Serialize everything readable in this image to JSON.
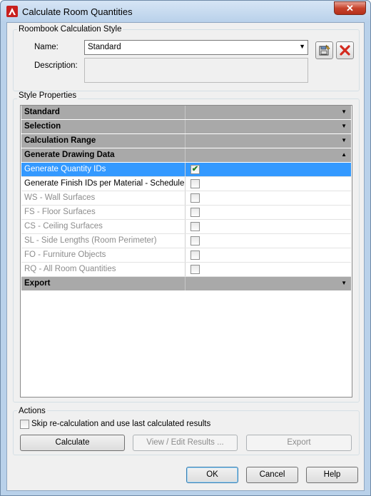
{
  "window": {
    "title": "Calculate Room Quantities",
    "close_glyph": "✕"
  },
  "style_group": {
    "label": "Roombook Calculation Style",
    "name_label": "Name:",
    "name_value": "Standard",
    "description_label": "Description:",
    "description_value": ""
  },
  "properties": {
    "label": "Style Properties",
    "rows": [
      {
        "name": "Standard",
        "kind": "category",
        "arrow": "▼"
      },
      {
        "name": "Selection",
        "kind": "category",
        "arrow": "▼"
      },
      {
        "name": "Calculation Range",
        "kind": "category",
        "arrow": "▼"
      },
      {
        "name": "Generate Drawing Data",
        "kind": "category",
        "arrow": "▲"
      },
      {
        "name": "Generate Quantity IDs",
        "kind": "selected",
        "checked": true
      },
      {
        "name": "Generate Finish IDs per Material - Schedule",
        "kind": "enabled",
        "checked": false
      },
      {
        "name": "WS - Wall Surfaces",
        "kind": "disabled",
        "checked": false
      },
      {
        "name": "FS - Floor Surfaces",
        "kind": "disabled",
        "checked": false
      },
      {
        "name": "CS - Ceiling Surfaces",
        "kind": "disabled",
        "checked": false
      },
      {
        "name": "SL - Side Lengths (Room Perimeter)",
        "kind": "disabled",
        "checked": false
      },
      {
        "name": "FO - Furniture Objects",
        "kind": "disabled",
        "checked": false
      },
      {
        "name": "RQ - All Room Quantities",
        "kind": "disabled",
        "checked": false
      },
      {
        "name": "Export",
        "kind": "category",
        "arrow": "▼"
      }
    ]
  },
  "actions": {
    "label": "Actions",
    "skip_label": "Skip re-calculation and use last calculated results",
    "skip_checked": false,
    "calculate_label": "Calculate",
    "view_edit_label": "View / Edit Results ...",
    "export_label": "Export"
  },
  "footer": {
    "ok_label": "OK",
    "cancel_label": "Cancel",
    "help_label": "Help"
  },
  "colors": {
    "selection": "#3399ff",
    "category": "#a9a9a9",
    "checkmark": "#1f7a1f"
  },
  "icons": {
    "app": "autocad-a-icon",
    "save_style": "save-style-icon",
    "delete_style": "delete-x-icon"
  }
}
